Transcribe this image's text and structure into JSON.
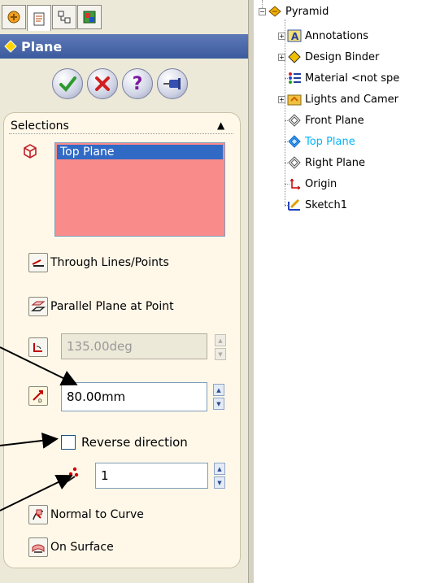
{
  "panel": {
    "title": "Plane",
    "tabs": [
      "feature-manager-icon",
      "property-manager-icon",
      "configuration-manager-icon",
      "dimxpert-icon"
    ]
  },
  "actions": {
    "ok": "ok-icon",
    "cancel": "cancel-icon",
    "help": "help-icon",
    "pin": "pushpin-icon"
  },
  "selections": {
    "header": "Selections",
    "item": "Top Plane"
  },
  "options": {
    "through": "Through Lines/Points",
    "parallel": "Parallel Plane at Point",
    "angle_value": "135.00deg",
    "offset_value": "80.00mm",
    "reverse": "Reverse direction",
    "count_value": "1",
    "normal": "Normal to Curve",
    "surface": "On Surface"
  },
  "tree": {
    "root": "Pyramid",
    "items": [
      {
        "label": "Annotations",
        "icon": "annotations-icon"
      },
      {
        "label": "Design Binder",
        "icon": "design-binder-icon"
      },
      {
        "label": "Material <not spe",
        "icon": "material-icon"
      },
      {
        "label": "Lights and Camer",
        "icon": "lights-folder-icon"
      },
      {
        "label": "Front Plane",
        "icon": "plane-icon"
      },
      {
        "label": "Top Plane",
        "icon": "plane-selected-icon"
      },
      {
        "label": "Right Plane",
        "icon": "plane-icon"
      },
      {
        "label": "Origin",
        "icon": "origin-icon"
      },
      {
        "label": "Sketch1",
        "icon": "sketch-icon"
      }
    ]
  },
  "colors": {
    "title_bar": "#3b5a9e",
    "selection_box": "#f98b8b",
    "selected_row": "#316ac5",
    "tree_selected_text": "#00b4ff"
  }
}
